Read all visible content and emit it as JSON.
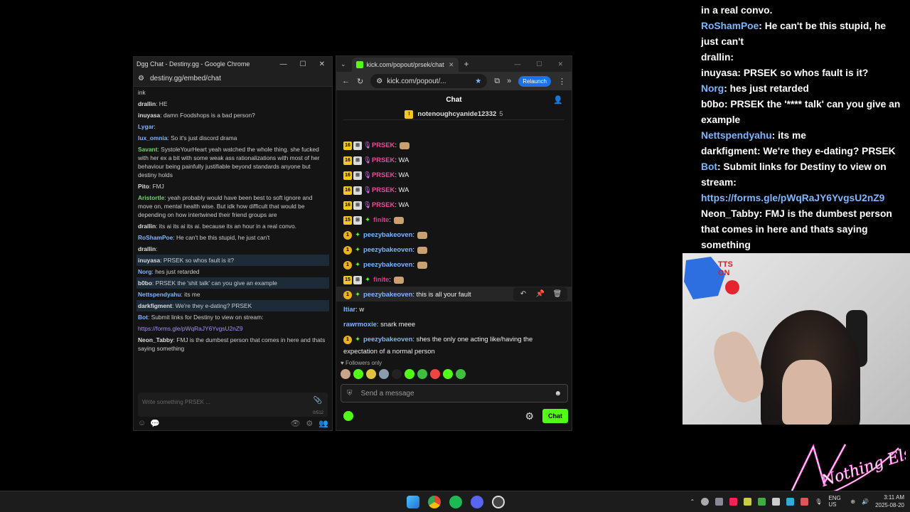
{
  "dgg": {
    "window_title": "Dgg Chat - Destiny.gg - Google Chrome",
    "url": "destiny.gg/embed/chat",
    "messages": [
      {
        "user": "",
        "text": "ink",
        "color": "#ccc",
        "hl": false
      },
      {
        "user": "drallin",
        "text": ": HE",
        "color": "#ddd",
        "hl": false
      },
      {
        "user": "inuyasa",
        "text": ": damn Foodshops is a bad person?",
        "color": "#ddd",
        "hl": false
      },
      {
        "user": "Lygar",
        "text": ":",
        "color": "#7fb6ff",
        "hl": false
      },
      {
        "user": "lux_omnia",
        "text": ": So it's just discord drama",
        "color": "#7fb6ff",
        "hl": false
      },
      {
        "user": "Savant",
        "text": ": SystoleYourHeart yeah watched the whole thing. she fucked with her ex a bit with some weak ass rationalizations with most of her behaviour being painfully justifiable beyond standards anyone but destiny holds",
        "color": "#6fd36f",
        "hl": false
      },
      {
        "user": "Pito",
        "text": ": FMJ",
        "color": "#ddd",
        "hl": false
      },
      {
        "user": "Aristortle",
        "text": ": yeah probably would have been best to soft ignore and move on, mental health wise. But idk how difficult that would be depending on how intertwined their friend groups are",
        "color": "#6fd36f",
        "hl": false
      },
      {
        "user": "drallin",
        "text": ": its ai its ai its ai. because its an hour in a real convo.",
        "color": "#ddd",
        "hl": false
      },
      {
        "user": "RoShamPoe",
        "text": ": He can't be this stupid, he just can't",
        "color": "#7fb6ff",
        "hl": false
      },
      {
        "user": "drallin",
        "text": ":",
        "color": "#ddd",
        "hl": false
      },
      {
        "user": "inuyasa",
        "text": ": PRSEK so whos fault is it?",
        "color": "#ddd",
        "hl": true
      },
      {
        "user": "Norg",
        "text": ": hes just retarded",
        "color": "#7fb6ff",
        "hl": false
      },
      {
        "user": "b0bo",
        "text": ": PRSEK the 'shit talk' can you give an example",
        "color": "#ddd",
        "hl": true
      },
      {
        "user": "Nettspendyahu",
        "text": ": its me",
        "color": "#7fb6ff",
        "hl": false
      },
      {
        "user": "darkfigment",
        "text": ": We're they e-dating? PRSEK",
        "color": "#ddd",
        "hl": true
      },
      {
        "user": "Bot",
        "text": ": Submit links for Destiny to view on stream:",
        "color": "#7fb6ff",
        "hl": false
      },
      {
        "user": "",
        "text": "https://forms.gle/pWqRaJY6YvgsU2nZ9",
        "color": "#a68ef4",
        "hl": false
      },
      {
        "user": "Neon_Tabby",
        "text": ": FMJ is the dumbest person that comes in here and thats saying something",
        "color": "#ddd",
        "hl": false
      }
    ],
    "input_placeholder": "Write something PRSEK ...",
    "char_count": "0/512"
  },
  "kick": {
    "tab_title": "kick.com/popout/prsek/chat",
    "url": "kick.com/popout/...",
    "relaunch": "Relaunch",
    "chat_title": "Chat",
    "pinned_user": "notenoughcyanide12332",
    "pinned_count": "5",
    "messages": [
      {
        "badges": [
          "16",
          "sub",
          "mic"
        ],
        "user": "PRSEK",
        "ucolor": "#e84b9c",
        "text": ":",
        "emote": true
      },
      {
        "badges": [
          "16",
          "sub",
          "mic"
        ],
        "user": "PRSEK",
        "ucolor": "#e84b9c",
        "text": ": WA",
        "emote": false
      },
      {
        "badges": [
          "16",
          "sub",
          "mic"
        ],
        "user": "PRSEK",
        "ucolor": "#e84b9c",
        "text": ": WA",
        "emote": false
      },
      {
        "badges": [
          "16",
          "sub",
          "mic"
        ],
        "user": "PRSEK",
        "ucolor": "#e84b9c",
        "text": ": WA",
        "emote": false
      },
      {
        "badges": [
          "16",
          "sub",
          "mic"
        ],
        "user": "PRSEK",
        "ucolor": "#e84b9c",
        "text": ": WA",
        "emote": false
      },
      {
        "badges": [
          "15",
          "sub",
          "star"
        ],
        "user": "finite",
        "ucolor": "#e0368b",
        "text": ":",
        "emote": true
      },
      {
        "badges": [
          "gift",
          "star"
        ],
        "user": "peezybakeoven",
        "ucolor": "#7fb6ff",
        "text": ":",
        "emote": true
      },
      {
        "badges": [
          "gift",
          "star"
        ],
        "user": "peezybakeoven",
        "ucolor": "#7fb6ff",
        "text": ":",
        "emote": true
      },
      {
        "badges": [
          "gift",
          "star"
        ],
        "user": "peezybakeoven",
        "ucolor": "#7fb6ff",
        "text": ":",
        "emote": true
      },
      {
        "badges": [
          "15",
          "sub",
          "star"
        ],
        "user": "finite",
        "ucolor": "#e0368b",
        "text": ":",
        "emote": true
      },
      {
        "badges": [
          "gift",
          "star"
        ],
        "user": "peezybakeoven",
        "ucolor": "#7fb6ff",
        "text": ": this is all your fault",
        "emote": false,
        "hover": true
      },
      {
        "badges": [],
        "user": "Itiar",
        "ucolor": "#7fb6ff",
        "text": ": w",
        "emote": false
      },
      {
        "badges": [],
        "user": "rawrmoxie",
        "ucolor": "#7fb6ff",
        "text": ": snark meee",
        "emote": false
      },
      {
        "badges": [
          "gift",
          "star"
        ],
        "user": "peezybakeoven",
        "ucolor": "#7fb6ff",
        "text": ": shes the only one acting like/having the expectation of a normal person",
        "emote": false
      }
    ],
    "followers_only": "Followers only",
    "send_placeholder": "Send a message",
    "chat_button": "Chat"
  },
  "overlay": [
    {
      "user": "",
      "text": "in a real convo.",
      "blue": false
    },
    {
      "user": "RoShamPoe",
      "text": ": He can't be this stupid, he just can't",
      "blue": true
    },
    {
      "user": "drallin",
      "text": ":",
      "blue": false
    },
    {
      "user": "inuyasa",
      "text": ": PRSEK so whos fault is it?",
      "blue": false
    },
    {
      "user": "Norg",
      "text": ": hes just retarded",
      "blue": true
    },
    {
      "user": "b0bo",
      "text": ": PRSEK the '**** talk' can you give an example",
      "blue": false
    },
    {
      "user": "Nettspendyahu",
      "text": ": its me",
      "blue": true
    },
    {
      "user": "darkfigment",
      "text": ": We're they e-dating? PRSEK",
      "blue": false
    },
    {
      "user": "Bot",
      "text": ": Submit links for Destiny to view on stream:",
      "blue": true
    },
    {
      "user": "",
      "text": "https://forms.gle/pWqRaJY6YvgsU2nZ9",
      "blue": false,
      "link": true
    },
    {
      "user": "Neon_Tabby",
      "text": ": FMJ is the dumbest person that comes in here and thats saying something",
      "blue": false
    }
  ],
  "cam": {
    "poster_text": "TTS ON"
  },
  "logo": {
    "text": "Nothing Else?"
  },
  "taskbar": {
    "lang": "ENG US",
    "time": "3:11 AM",
    "date": "2025-08-20"
  },
  "colors": {
    "kick_green": "#53fc18",
    "dgg_link": "#a68ef4",
    "chrome_blue": "#1a73e8"
  }
}
